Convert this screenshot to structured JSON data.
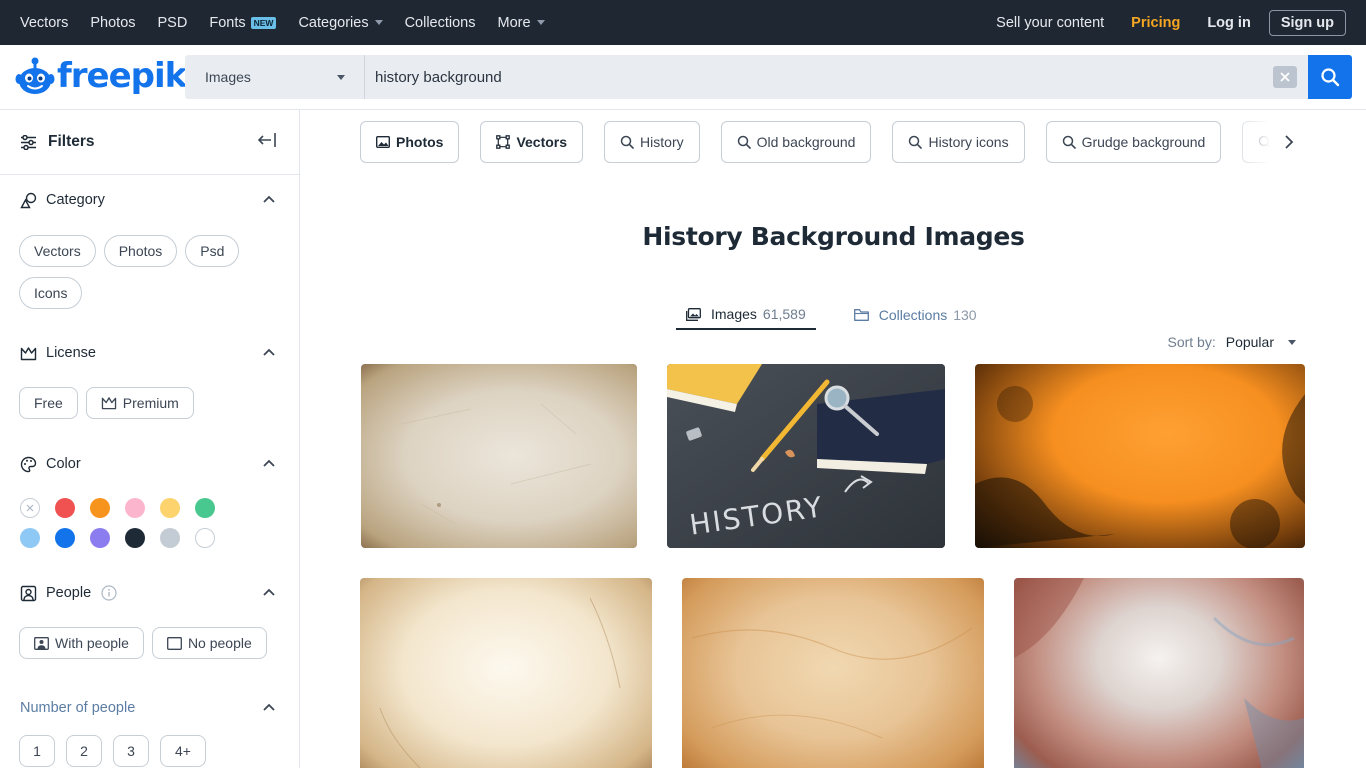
{
  "topnav": {
    "links": [
      {
        "label": "Vectors"
      },
      {
        "label": "Photos"
      },
      {
        "label": "PSD"
      },
      {
        "label": "Fonts",
        "badge": "NEW"
      },
      {
        "label": "Categories"
      },
      {
        "label": "Collections"
      },
      {
        "label": "More"
      }
    ],
    "sell": "Sell your content",
    "pricing": "Pricing",
    "login": "Log in",
    "signup": "Sign up"
  },
  "header": {
    "logo_text": "freepik",
    "search_type": "Images",
    "search_value": "history background"
  },
  "sidebar": {
    "title": "Filters",
    "category": {
      "label": "Category",
      "chips": [
        "Vectors",
        "Photos",
        "Psd",
        "Icons"
      ]
    },
    "license": {
      "label": "License",
      "chips": [
        "Free",
        "Premium"
      ]
    },
    "color": {
      "label": "Color",
      "swatches": [
        "#ffffff",
        "#f05252",
        "#f7941d",
        "#fbb6ce",
        "#fcd36d",
        "#48c78e",
        "#8ec9f5",
        "#1273eb",
        "#8b7cf0",
        "#1e2a36",
        "#c3cbd4",
        "#ffffff"
      ]
    },
    "people": {
      "label": "People",
      "chips": [
        "With people",
        "No people"
      ]
    },
    "number_of_people": {
      "label": "Number of people",
      "chips": [
        "1",
        "2",
        "3",
        "4+"
      ]
    }
  },
  "main": {
    "tags": [
      {
        "label": "Photos",
        "icon": "image-icon"
      },
      {
        "label": "Vectors",
        "icon": "vector-icon"
      },
      {
        "label": "History",
        "icon": "search-icon"
      },
      {
        "label": "Old background",
        "icon": "search-icon"
      },
      {
        "label": "History icons",
        "icon": "search-icon"
      },
      {
        "label": "Grudge background",
        "icon": "search-icon"
      },
      {
        "label": "V",
        "icon": "search-icon"
      }
    ],
    "title": "History Background Images",
    "tabs": [
      {
        "label": "Images",
        "count": "61,589"
      },
      {
        "label": "Collections",
        "count": "130"
      }
    ],
    "sort_label": "Sort by:",
    "sort_value": "Popular",
    "chalk_text": "HISTORY"
  }
}
